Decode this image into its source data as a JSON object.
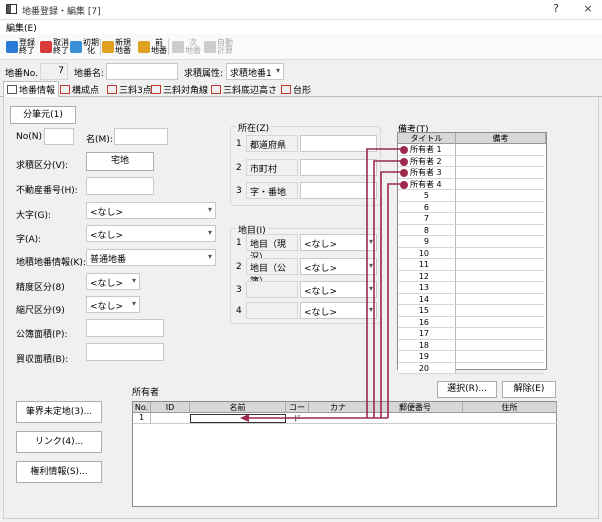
{
  "window": {
    "title": "地番登録・編集 [7]",
    "help": "?",
    "close": "×"
  },
  "menu": {
    "edit": "編集(E)"
  },
  "toolbar": [
    {
      "label": "登録\n終了",
      "color": "#2b7bd6",
      "disabled": false
    },
    {
      "label": "取消\n終了",
      "color": "#d93a3a",
      "disabled": false
    },
    {
      "label": "初期\n化",
      "color": "#3a8fd9",
      "disabled": false
    },
    {
      "label": "新規\n地番",
      "color": "#e0a020",
      "disabled": false
    },
    {
      "label": "前\n地番",
      "color": "#e0a020",
      "disabled": false
    },
    {
      "label": "次\n地番",
      "color": "#cccccc",
      "disabled": true
    },
    {
      "label": "自動\n計算",
      "color": "#cccccc",
      "disabled": true
    }
  ],
  "header": {
    "no_label": "地番No.",
    "no_value": "7",
    "chiban_label": "地番名:",
    "chiban_value": "",
    "attr_label": "求積属性:",
    "attr_value": "求積地番1"
  },
  "tabs": [
    {
      "label": "地番情報",
      "active": true
    },
    {
      "label": "構成点"
    },
    {
      "label": "三斜3点"
    },
    {
      "label": "三斜対角線"
    },
    {
      "label": "三斜底辺高さ"
    },
    {
      "label": "台形"
    }
  ],
  "left": {
    "bunhittsu": "分筆元(1)",
    "no_label": "No(N)",
    "name_label": "名(M):",
    "kubun_label": "求積区分(V):",
    "kubun_value": "宅地",
    "fudosan_label": "不動産番号(H):",
    "oaza_label": "大字(G):",
    "oaza_value": "<なし>",
    "aza_label": "字(A):",
    "aza_value": "<なし>",
    "chiban_info_label": "地積地番情報(K):",
    "chiban_info_value": "普通地番",
    "seido_label": "精度区分(8)",
    "seido_value": "<なし>",
    "shukushaku_label": "縮尺区分(9)",
    "shukushaku_value": "<なし>",
    "kobo_label": "公簿面積(P):",
    "baishu_label": "買収面積(B):"
  },
  "shozai": {
    "title": "所在(Z)",
    "rows": [
      {
        "num": "1",
        "label": "都道府県"
      },
      {
        "num": "2",
        "label": "市町村"
      },
      {
        "num": "3",
        "label": "字・番地"
      }
    ]
  },
  "chimoku": {
    "title": "地目(I)",
    "rows": [
      {
        "num": "1",
        "label": "地目（現況）",
        "value": "<なし>"
      },
      {
        "num": "2",
        "label": "地目（公簿）",
        "value": "<なし>"
      },
      {
        "num": "3",
        "label": "",
        "value": "<なし>"
      },
      {
        "num": "4",
        "label": "",
        "value": "<なし>"
      }
    ]
  },
  "biko": {
    "title": "備考(T)",
    "col_title": "タイトル",
    "col_biko": "備考",
    "rows": [
      "所有者 1",
      "所有者 2",
      "所有者 3",
      "所有者 4",
      "5",
      "6",
      "7",
      "8",
      "9",
      "10",
      "11",
      "12",
      "13",
      "14",
      "15",
      "16",
      "17",
      "18",
      "19",
      "20"
    ]
  },
  "owners": {
    "title": "所有者",
    "select_button": "選択(R)...",
    "remove_button": "解除(E)",
    "columns": [
      "No.",
      "ID",
      "名前",
      "コード",
      "カナ",
      "郵便番号",
      "住所"
    ],
    "row_no": "1"
  },
  "side_buttons": [
    "筆界未定地(3)...",
    "リンク(4)...",
    "権利情報(S)..."
  ],
  "colors": {
    "accent": "#9c2a4c"
  }
}
